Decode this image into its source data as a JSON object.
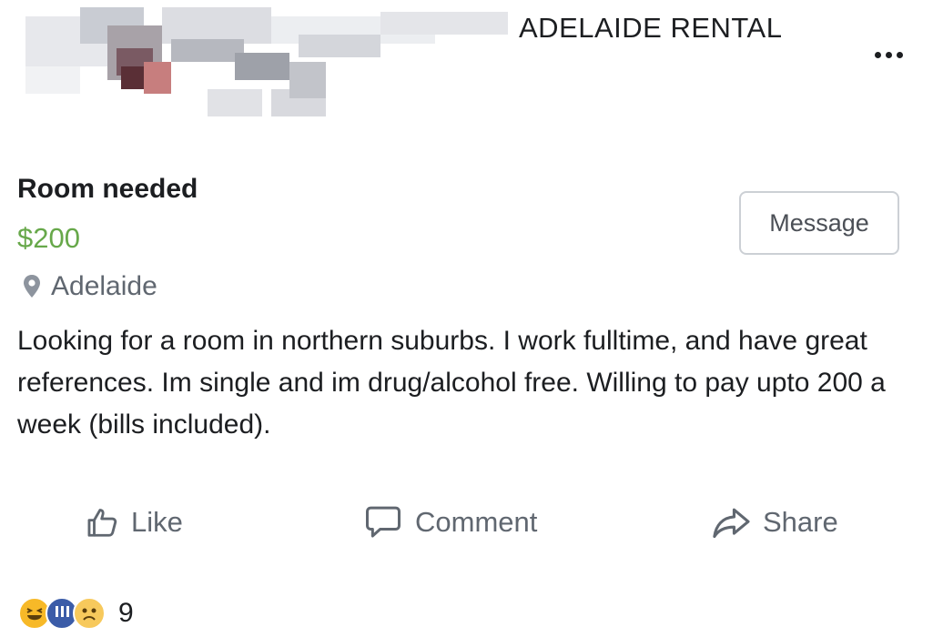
{
  "header": {
    "group_name": "ADELAIDE RENTAL",
    "more_icon": "more-horizontal-icon"
  },
  "listing": {
    "title": "Room needed",
    "price": "$200",
    "location": "Adelaide",
    "location_icon": "location-pin-icon",
    "message_label": "Message",
    "description": "Looking for a room in northern suburbs. I work fulltime, and have great references. Im single and im drug/alcohol free. Willing to pay upto 200 a week (bills included)."
  },
  "actions": {
    "like_label": "Like",
    "comment_label": "Comment",
    "share_label": "Share"
  },
  "reactions": {
    "types": [
      "haha",
      "wow",
      "sad"
    ],
    "count": "9"
  },
  "colors": {
    "price": "#67a84a",
    "muted_text": "#606770",
    "button_border": "#ccd0d5"
  }
}
